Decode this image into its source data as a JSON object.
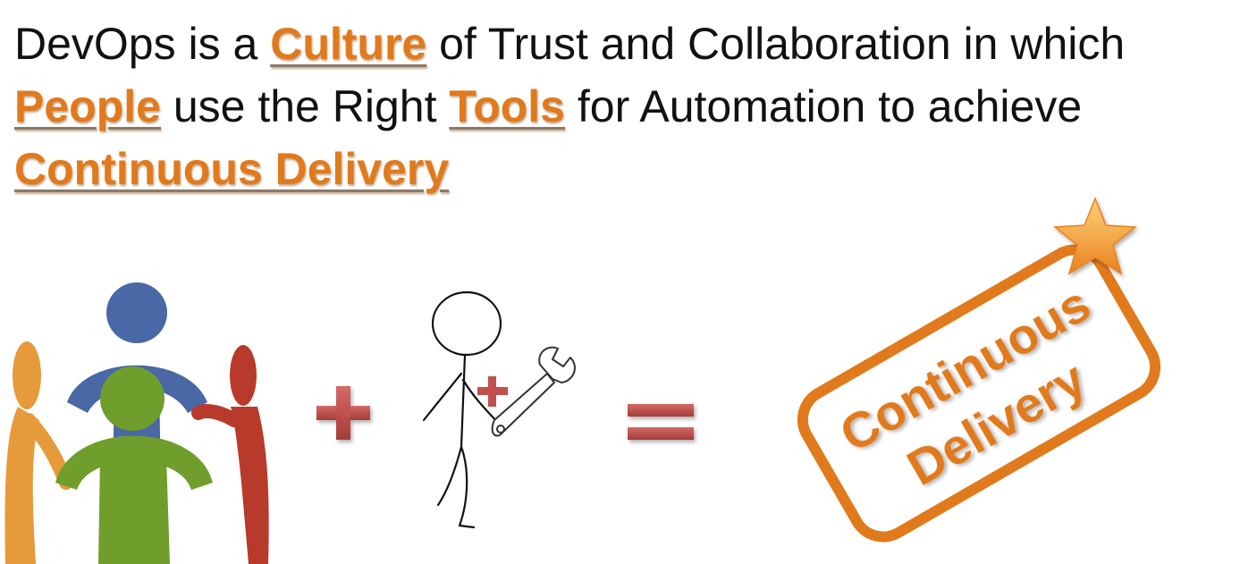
{
  "headline": {
    "p1": "DevOps is a ",
    "kw1": "Culture",
    "p2": " of Trust and Collaboration in which ",
    "kw2": "People",
    "p3": " use the Right ",
    "kw3": "Tools",
    "p4": " for Automation to achieve ",
    "kw4": "Continuous Delivery"
  },
  "badge": {
    "line1": "Continuous",
    "line2": "Delivery"
  },
  "colors": {
    "accent": "#e07a1c",
    "operator": "#c0504d",
    "person_blue": "#4a67a6",
    "person_green": "#6f9e2c",
    "person_orange": "#e69a3a",
    "person_red": "#b83a2a"
  },
  "icons": [
    "people-circle-icon",
    "plus-icon",
    "stick-figure-icon",
    "wrench-icon",
    "equals-icon",
    "star-icon"
  ]
}
